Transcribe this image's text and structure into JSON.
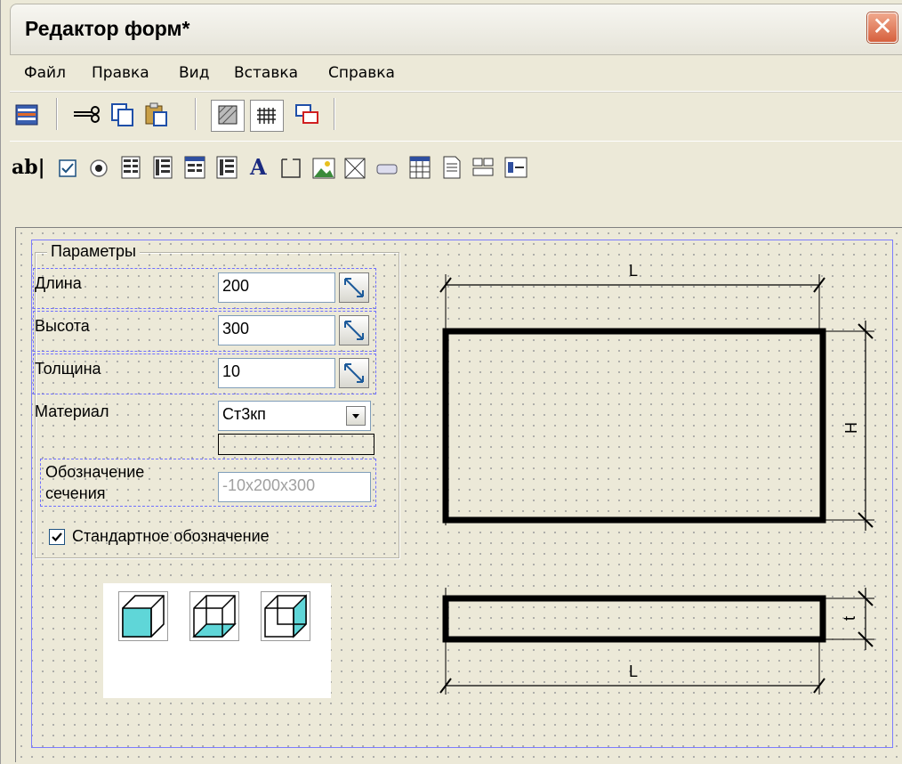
{
  "window": {
    "title": "Редактор форм*",
    "close_symbol": "✕"
  },
  "menu": [
    "Файл",
    "Правка",
    "Вид",
    "Вставка",
    "Справка"
  ],
  "toolbar1": [
    "form-properties-icon",
    "cut-icon",
    "copy-icon",
    "paste-icon",
    "fill-pattern-icon",
    "grid-icon",
    "overlap-icon"
  ],
  "toolbar2": {
    "text_tool_label": "ab|",
    "text_label_tool": "A",
    "items": [
      "textbox-tool-icon",
      "checkbox-tool-icon",
      "radio-tool-icon",
      "list-tool-icon",
      "list2-tool-icon",
      "table-tool-icon",
      "table2-tool-icon",
      "label-tool-icon",
      "group-tool-icon",
      "picture-tool-icon",
      "frame-tool-icon",
      "button-tool-icon",
      "grid-tool-icon",
      "page-tool-icon",
      "component-tool-icon",
      "slider-tool-icon"
    ]
  },
  "params": {
    "group_label": "Параметры",
    "length_label": "Длина",
    "length_value": "200",
    "height_label": "Высота",
    "height_value": "300",
    "thickness_label": "Толщина",
    "thickness_value": "10",
    "material_label": "Материал",
    "material_value": "Ст3кп",
    "designation_label_1": "Обозначение",
    "designation_label_2": "сечения",
    "designation_value": "-10x200x300",
    "checkbox_label": "Стандартное обозначение",
    "checkbox_checked": true
  },
  "drawing": {
    "top_dim": "L",
    "side_dim": "H",
    "thick_dim": "t",
    "bottom_dim": "L"
  },
  "colors": {
    "cube_fill": "#5fd6d8",
    "frame": "#7c7cff"
  }
}
